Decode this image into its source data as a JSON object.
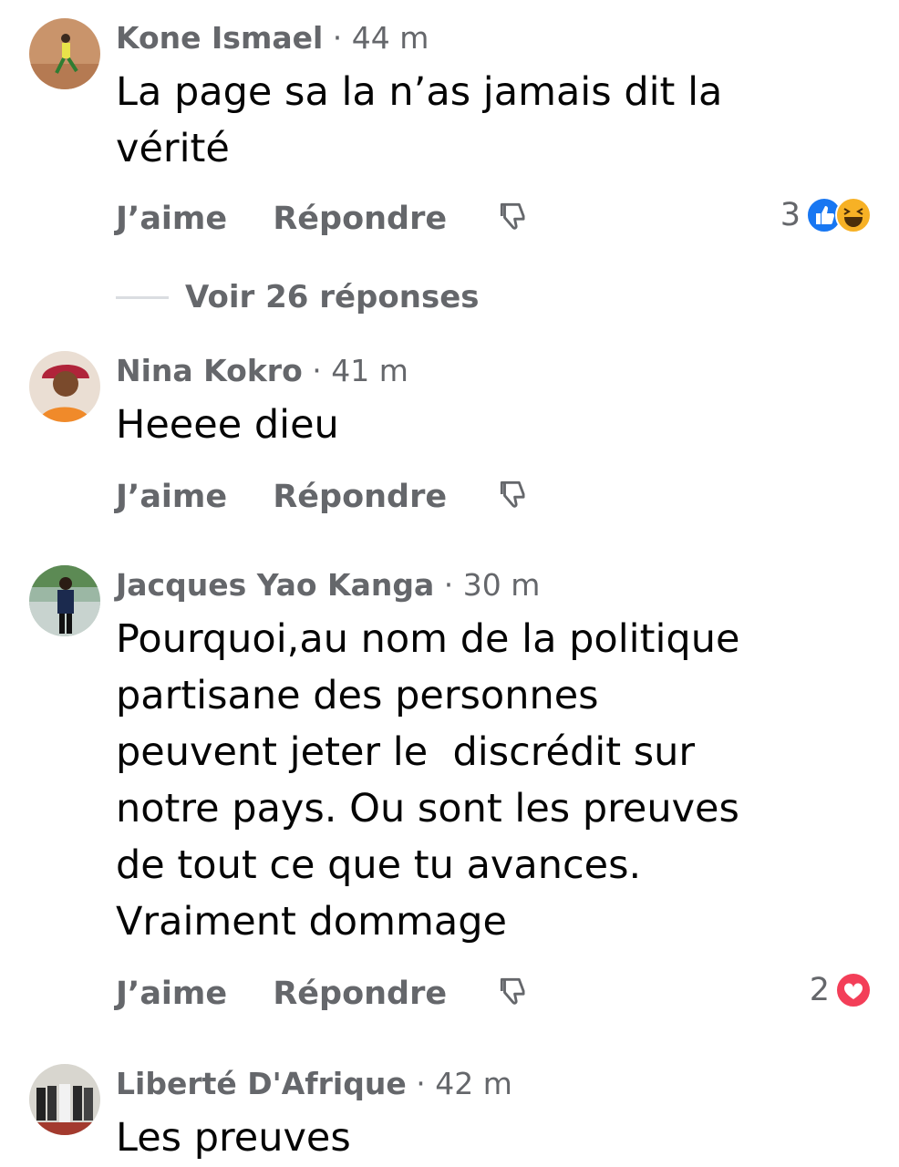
{
  "comments": [
    {
      "name": "Kone Ismael",
      "separator": "·",
      "time": "44 m",
      "text": "La page sa la n’as jamais dit la\nvérité",
      "like_label": "J’aime",
      "reply_label": "Répondre",
      "reaction_count": "3",
      "reactions": [
        "like-icon",
        "haha-icon"
      ]
    },
    {
      "name": "Nina Kokro",
      "separator": "·",
      "time": "41 m",
      "text": "Heeee dieu",
      "like_label": "J’aime",
      "reply_label": "Répondre"
    },
    {
      "name": "Jacques Yao Kanga",
      "separator": "·",
      "time": "30 m",
      "text": "Pourquoi,au nom de la politique\npartisane des personnes\npeuvent jeter le  discrédit sur\nnotre pays. Ou sont les preuves\nde tout ce que tu avances.\nVraiment dommage",
      "like_label": "J’aime",
      "reply_label": "Répondre",
      "reaction_count": "2",
      "reactions": [
        "love-icon"
      ]
    },
    {
      "name": "Liberté D'Afrique",
      "separator": "·",
      "time": "42 m",
      "text": "Les preuves"
    }
  ],
  "view_replies": "Voir 26 réponses",
  "colors": {
    "secondary_text": "#65676b",
    "primary_text": "#050505",
    "like_blue": "#1877f2",
    "love_red": "#f33e58",
    "haha_yellow": "#f7b125"
  }
}
